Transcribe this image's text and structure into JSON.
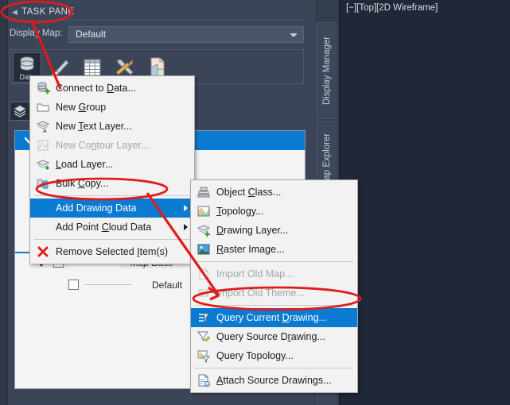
{
  "app": {
    "task_pane_title": "TASK PANE",
    "viewport_label": "[−][Top][2D Wireframe]"
  },
  "display_map": {
    "label": "Display Map:",
    "value": "Default",
    "dropdown_icon": "chevron-down-icon"
  },
  "toolbar": {
    "buttons": [
      {
        "name": "data-button",
        "caption": "Data",
        "icon": "database-icon",
        "selected": true
      },
      {
        "name": "style-button",
        "caption": "",
        "icon": "paintbrush-icon",
        "selected": false
      },
      {
        "name": "table-button",
        "caption": "",
        "icon": "table-grid-icon",
        "selected": false
      },
      {
        "name": "tools-button",
        "caption": "",
        "icon": "hammer-wrench-icon",
        "selected": false
      },
      {
        "name": "report-button",
        "caption": "",
        "icon": "document-icon",
        "selected": false
      }
    ],
    "layers_button_icon": "layers-stack-icon"
  },
  "dock_tabs": [
    {
      "label": "Display Manager"
    },
    {
      "label": "Map Explorer"
    },
    {
      "label": ""
    }
  ],
  "tree": {
    "rows": [
      {
        "chevron": "chevron-down-icon",
        "checked": true,
        "swatch": "",
        "label": "",
        "selected": true
      },
      {
        "chevron": "chevron-down-icon",
        "checked": true,
        "swatch": "",
        "label": "Map Base",
        "selected": false,
        "italic": true
      },
      {
        "chevron": "",
        "checked": false,
        "swatch": "line",
        "label": "Default",
        "selected": false
      }
    ]
  },
  "context_menu": {
    "items": [
      {
        "label": "Connect to Data...",
        "accel": "D",
        "icon": "database-add-icon",
        "state": "normal",
        "submenu": false
      },
      {
        "label": "New Group",
        "accel": "G",
        "icon": "folder-icon",
        "state": "normal",
        "submenu": false
      },
      {
        "label": "New Text Layer...",
        "accel": "T",
        "icon": "text-layer-icon",
        "state": "normal",
        "submenu": false
      },
      {
        "label": "New Contour Layer...",
        "accel": "n",
        "icon": "contour-layer-icon",
        "state": "disabled",
        "submenu": false
      },
      {
        "label": "Load Layer...",
        "accel": "L",
        "icon": "load-layer-icon",
        "state": "normal",
        "submenu": false
      },
      {
        "label": "Bulk Copy...",
        "accel": "C",
        "icon": "bulk-copy-icon",
        "state": "normal",
        "submenu": false
      },
      {
        "separator": true
      },
      {
        "label": "Add Drawing Data",
        "accel": "",
        "icon": "",
        "state": "highlight",
        "submenu": true
      },
      {
        "label": "Add Point Cloud Data",
        "accel": "C",
        "icon": "",
        "state": "normal",
        "submenu": true
      },
      {
        "separator": true
      },
      {
        "label": "Remove Selected Item(s)",
        "accel": "I",
        "icon": "red-x-icon",
        "state": "normal",
        "submenu": false
      }
    ]
  },
  "submenu": {
    "items": [
      {
        "label": "Object Class...",
        "accel": "C",
        "icon": "object-class-icon",
        "state": "normal"
      },
      {
        "label": "Topology...",
        "accel": "T",
        "icon": "topology-icon",
        "state": "normal"
      },
      {
        "label": "Drawing Layer...",
        "accel": "D",
        "icon": "drawing-layer-icon",
        "state": "normal"
      },
      {
        "label": "Raster Image...",
        "accel": "R",
        "icon": "raster-image-icon",
        "state": "normal"
      },
      {
        "separator": true
      },
      {
        "label": "Import Old Map...",
        "accel": "",
        "icon": "import-old-map-icon",
        "state": "disabled"
      },
      {
        "label": "Import Old Theme...",
        "accel": "",
        "icon": "import-old-theme-icon",
        "state": "disabled"
      },
      {
        "separator": true
      },
      {
        "label": "Query Current Drawing...",
        "accel": "D",
        "icon": "query-current-drawing-icon",
        "state": "highlight"
      },
      {
        "label": "Query Source Drawing...",
        "accel": "r",
        "icon": "query-source-drawing-icon",
        "state": "normal"
      },
      {
        "label": "Query Topology...",
        "accel": "",
        "icon": "query-topology-icon",
        "state": "normal"
      },
      {
        "separator": true
      },
      {
        "label": "Attach Source Drawings...",
        "accel": "A",
        "icon": "attach-source-drawings-icon",
        "state": "normal"
      }
    ]
  },
  "annotations": {
    "color": "#e01b1b",
    "ellipses": [
      {
        "name": "task-pane-callout"
      },
      {
        "name": "add-drawing-data-callout"
      },
      {
        "name": "query-current-drawing-callout"
      }
    ],
    "arrows": [
      {
        "name": "task-pane-to-data-button-arrow"
      },
      {
        "name": "add-drawing-data-to-query-arrow"
      }
    ]
  },
  "colors": {
    "accent_blue": "#0b7ad1",
    "chrome_dark": "#3b4557",
    "viewport_bg": "#202736",
    "menu_bg": "#f2f2f2",
    "annotation_red": "#e01b1b"
  }
}
